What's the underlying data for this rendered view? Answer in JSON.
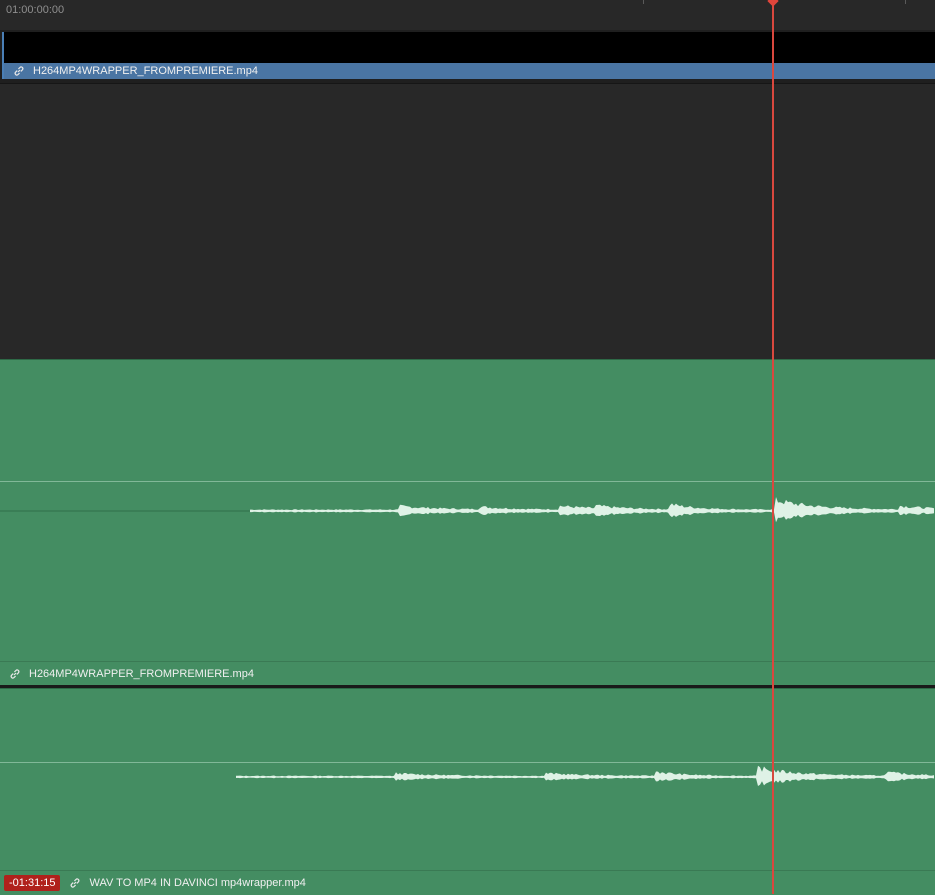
{
  "ruler": {
    "start_timecode": "01:00:00:00"
  },
  "video_track": {
    "clip": {
      "name": "H264MP4WRAPPER_FROMPREMIERE.mp4",
      "color": "#4a75a3",
      "linked": true
    }
  },
  "audio_tracks": [
    {
      "clip": {
        "name": "H264MP4WRAPPER_FROMPREMIERE.mp4",
        "color": "#448d62",
        "linked": true
      }
    },
    {
      "clip": {
        "name": "WAV TO MP4 IN DAVINCI mp4wrapper.mp4",
        "color": "#448d62",
        "linked": true,
        "offset_badge": "-01:31:15"
      }
    }
  ],
  "playhead": {
    "color": "#d9483e"
  }
}
